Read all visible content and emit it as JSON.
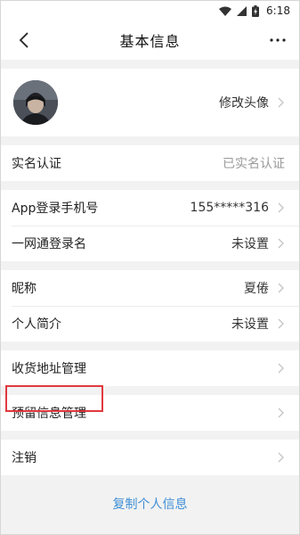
{
  "status_bar": {
    "time": "6:18",
    "icons": [
      "wifi-icon",
      "signal-icon",
      "battery-charging-icon"
    ]
  },
  "nav": {
    "title": "基本信息",
    "back_icon": "chevron-left-icon",
    "more_label": "⋯"
  },
  "profile": {
    "avatar_label": "修改头像"
  },
  "realname": {
    "label": "实名认证",
    "value": "已实名认证"
  },
  "login": {
    "phone_label": "App登录手机号",
    "phone_value": "155*****316",
    "alias_label": "一网通登录名",
    "alias_value": "未设置"
  },
  "personal": {
    "nickname_label": "昵称",
    "nickname_value": "夏倦",
    "bio_label": "个人简介",
    "bio_value": "未设置"
  },
  "address": {
    "label": "收货地址管理"
  },
  "reserved": {
    "label": "预留信息管理"
  },
  "cancel": {
    "label": "注销"
  },
  "footer": {
    "copy_label": "复制个人信息"
  },
  "colors": {
    "background": "#f2f2f2",
    "link": "#3f8fd6",
    "highlight": "#e0393e"
  }
}
